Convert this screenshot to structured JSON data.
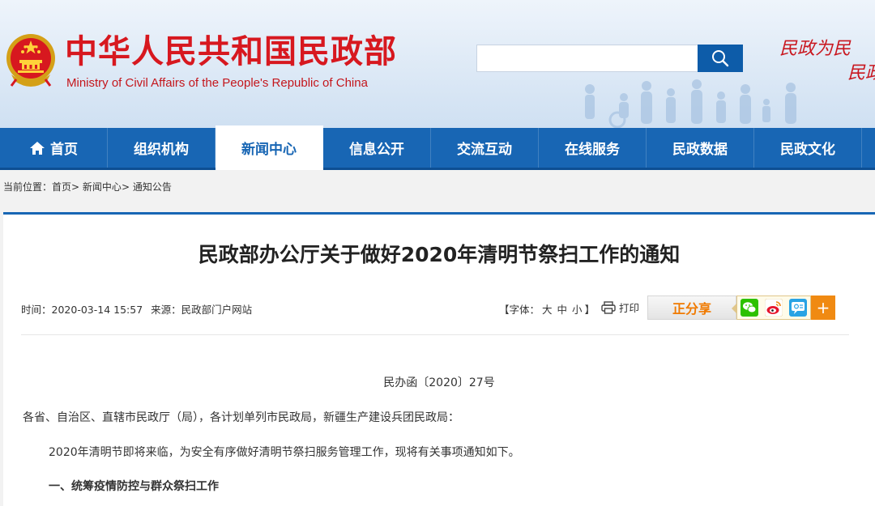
{
  "header": {
    "site_title": "中华人民共和国民政部",
    "site_subtitle": "Ministry of Civil Affairs of the People's Republic of China",
    "search": {
      "value": "",
      "placeholder": ""
    },
    "slogan_line1": "民政为民",
    "slogan_line2": "民政",
    "brand_red": "#d7181f",
    "emblem_icon": "national-emblem-icon"
  },
  "nav": {
    "items": [
      {
        "label": "首页",
        "icon": "home-icon"
      },
      {
        "label": "组织机构"
      },
      {
        "label": "新闻中心",
        "active": true
      },
      {
        "label": "信息公开"
      },
      {
        "label": "交流互动"
      },
      {
        "label": "在线服务"
      },
      {
        "label": "民政数据"
      },
      {
        "label": "民政文化"
      }
    ],
    "bg_color": "#1866b4"
  },
  "breadcrumb": {
    "prefix": "当前位置：",
    "items": [
      "首页",
      "新闻中心",
      "通知公告"
    ],
    "separator": ">"
  },
  "article": {
    "title": "民政部办公厅关于做好2020年清明节祭扫工作的通知",
    "time_label": "时间：",
    "time": "2020-03-14 15:57",
    "source_label": "来源：",
    "source": "民政部门户网站",
    "font_label_open": "【字体：",
    "font_sizes": [
      "大",
      "中",
      "小"
    ],
    "font_label_close": "】",
    "print_label": "打印",
    "share_label": "正分享",
    "share_icons": [
      "wechat-icon",
      "weibo-icon",
      "qq-icon"
    ],
    "share_more": "+",
    "doc_number": "民办函〔2020〕27号",
    "recipients": "各省、自治区、直辖市民政厅（局），各计划单列市民政局，新疆生产建设兵团民政局：",
    "paragraph_1": "2020年清明节即将来临，为安全有序做好清明节祭扫服务管理工作，现将有关事项通知如下。",
    "section_1": "一、统筹疫情防控与群众祭扫工作"
  }
}
